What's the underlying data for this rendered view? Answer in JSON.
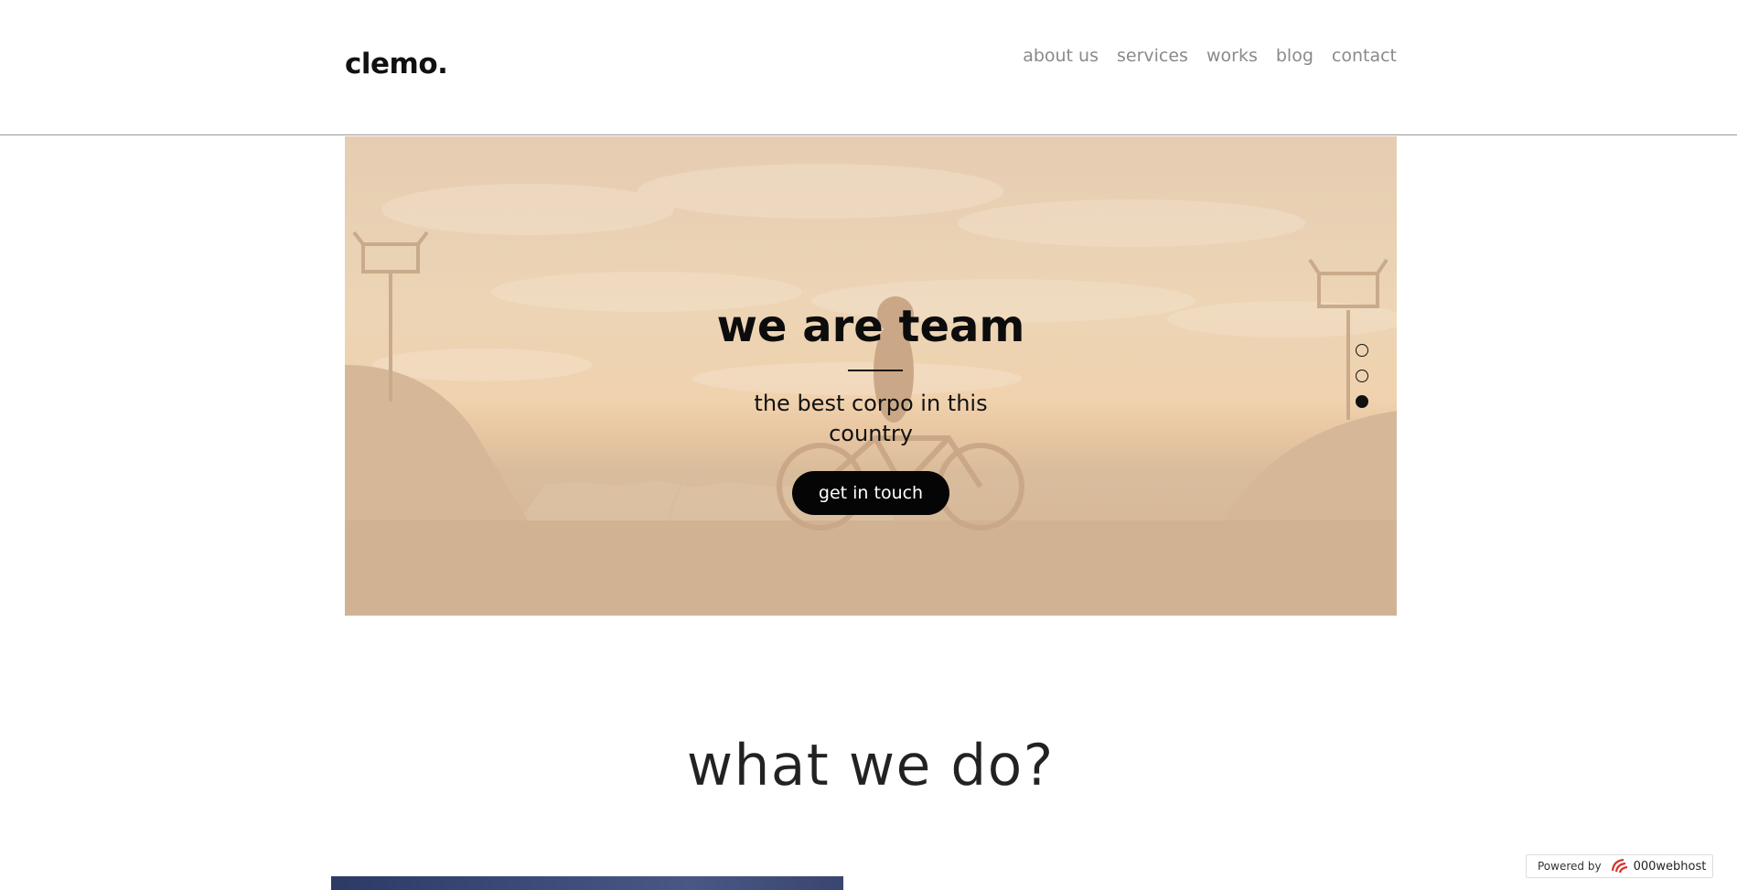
{
  "header": {
    "logo": "clemo.",
    "nav": [
      "about us",
      "services",
      "works",
      "blog",
      "contact"
    ]
  },
  "hero": {
    "title": "we are team",
    "subtitle": "the best corpo in this country",
    "button_label": "get in touch",
    "slides": {
      "count": 3,
      "active_index": 2
    }
  },
  "section": {
    "title": "what we do?"
  },
  "badge": {
    "prefix": "Powered by",
    "brand": "000webhost"
  },
  "colors": {
    "hero_overlay": "#ecd4b5",
    "button_bg": "#050505",
    "nav_text": "#8a8a8a"
  }
}
